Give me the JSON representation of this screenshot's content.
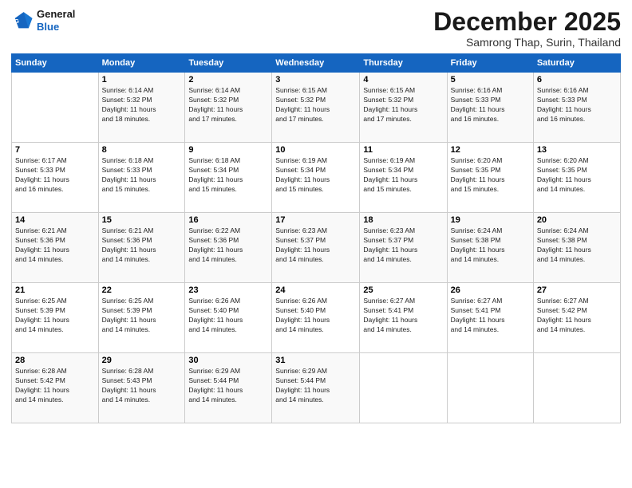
{
  "logo": {
    "line1": "General",
    "line2": "Blue"
  },
  "title": "December 2025",
  "location": "Samrong Thap, Surin, Thailand",
  "headers": [
    "Sunday",
    "Monday",
    "Tuesday",
    "Wednesday",
    "Thursday",
    "Friday",
    "Saturday"
  ],
  "weeks": [
    [
      {
        "day": "",
        "info": ""
      },
      {
        "day": "1",
        "info": "Sunrise: 6:14 AM\nSunset: 5:32 PM\nDaylight: 11 hours\nand 18 minutes."
      },
      {
        "day": "2",
        "info": "Sunrise: 6:14 AM\nSunset: 5:32 PM\nDaylight: 11 hours\nand 17 minutes."
      },
      {
        "day": "3",
        "info": "Sunrise: 6:15 AM\nSunset: 5:32 PM\nDaylight: 11 hours\nand 17 minutes."
      },
      {
        "day": "4",
        "info": "Sunrise: 6:15 AM\nSunset: 5:32 PM\nDaylight: 11 hours\nand 17 minutes."
      },
      {
        "day": "5",
        "info": "Sunrise: 6:16 AM\nSunset: 5:33 PM\nDaylight: 11 hours\nand 16 minutes."
      },
      {
        "day": "6",
        "info": "Sunrise: 6:16 AM\nSunset: 5:33 PM\nDaylight: 11 hours\nand 16 minutes."
      }
    ],
    [
      {
        "day": "7",
        "info": "Sunrise: 6:17 AM\nSunset: 5:33 PM\nDaylight: 11 hours\nand 16 minutes."
      },
      {
        "day": "8",
        "info": "Sunrise: 6:18 AM\nSunset: 5:33 PM\nDaylight: 11 hours\nand 15 minutes."
      },
      {
        "day": "9",
        "info": "Sunrise: 6:18 AM\nSunset: 5:34 PM\nDaylight: 11 hours\nand 15 minutes."
      },
      {
        "day": "10",
        "info": "Sunrise: 6:19 AM\nSunset: 5:34 PM\nDaylight: 11 hours\nand 15 minutes."
      },
      {
        "day": "11",
        "info": "Sunrise: 6:19 AM\nSunset: 5:34 PM\nDaylight: 11 hours\nand 15 minutes."
      },
      {
        "day": "12",
        "info": "Sunrise: 6:20 AM\nSunset: 5:35 PM\nDaylight: 11 hours\nand 15 minutes."
      },
      {
        "day": "13",
        "info": "Sunrise: 6:20 AM\nSunset: 5:35 PM\nDaylight: 11 hours\nand 14 minutes."
      }
    ],
    [
      {
        "day": "14",
        "info": "Sunrise: 6:21 AM\nSunset: 5:36 PM\nDaylight: 11 hours\nand 14 minutes."
      },
      {
        "day": "15",
        "info": "Sunrise: 6:21 AM\nSunset: 5:36 PM\nDaylight: 11 hours\nand 14 minutes."
      },
      {
        "day": "16",
        "info": "Sunrise: 6:22 AM\nSunset: 5:36 PM\nDaylight: 11 hours\nand 14 minutes."
      },
      {
        "day": "17",
        "info": "Sunrise: 6:23 AM\nSunset: 5:37 PM\nDaylight: 11 hours\nand 14 minutes."
      },
      {
        "day": "18",
        "info": "Sunrise: 6:23 AM\nSunset: 5:37 PM\nDaylight: 11 hours\nand 14 minutes."
      },
      {
        "day": "19",
        "info": "Sunrise: 6:24 AM\nSunset: 5:38 PM\nDaylight: 11 hours\nand 14 minutes."
      },
      {
        "day": "20",
        "info": "Sunrise: 6:24 AM\nSunset: 5:38 PM\nDaylight: 11 hours\nand 14 minutes."
      }
    ],
    [
      {
        "day": "21",
        "info": "Sunrise: 6:25 AM\nSunset: 5:39 PM\nDaylight: 11 hours\nand 14 minutes."
      },
      {
        "day": "22",
        "info": "Sunrise: 6:25 AM\nSunset: 5:39 PM\nDaylight: 11 hours\nand 14 minutes."
      },
      {
        "day": "23",
        "info": "Sunrise: 6:26 AM\nSunset: 5:40 PM\nDaylight: 11 hours\nand 14 minutes."
      },
      {
        "day": "24",
        "info": "Sunrise: 6:26 AM\nSunset: 5:40 PM\nDaylight: 11 hours\nand 14 minutes."
      },
      {
        "day": "25",
        "info": "Sunrise: 6:27 AM\nSunset: 5:41 PM\nDaylight: 11 hours\nand 14 minutes."
      },
      {
        "day": "26",
        "info": "Sunrise: 6:27 AM\nSunset: 5:41 PM\nDaylight: 11 hours\nand 14 minutes."
      },
      {
        "day": "27",
        "info": "Sunrise: 6:27 AM\nSunset: 5:42 PM\nDaylight: 11 hours\nand 14 minutes."
      }
    ],
    [
      {
        "day": "28",
        "info": "Sunrise: 6:28 AM\nSunset: 5:42 PM\nDaylight: 11 hours\nand 14 minutes."
      },
      {
        "day": "29",
        "info": "Sunrise: 6:28 AM\nSunset: 5:43 PM\nDaylight: 11 hours\nand 14 minutes."
      },
      {
        "day": "30",
        "info": "Sunrise: 6:29 AM\nSunset: 5:44 PM\nDaylight: 11 hours\nand 14 minutes."
      },
      {
        "day": "31",
        "info": "Sunrise: 6:29 AM\nSunset: 5:44 PM\nDaylight: 11 hours\nand 14 minutes."
      },
      {
        "day": "",
        "info": ""
      },
      {
        "day": "",
        "info": ""
      },
      {
        "day": "",
        "info": ""
      }
    ]
  ]
}
